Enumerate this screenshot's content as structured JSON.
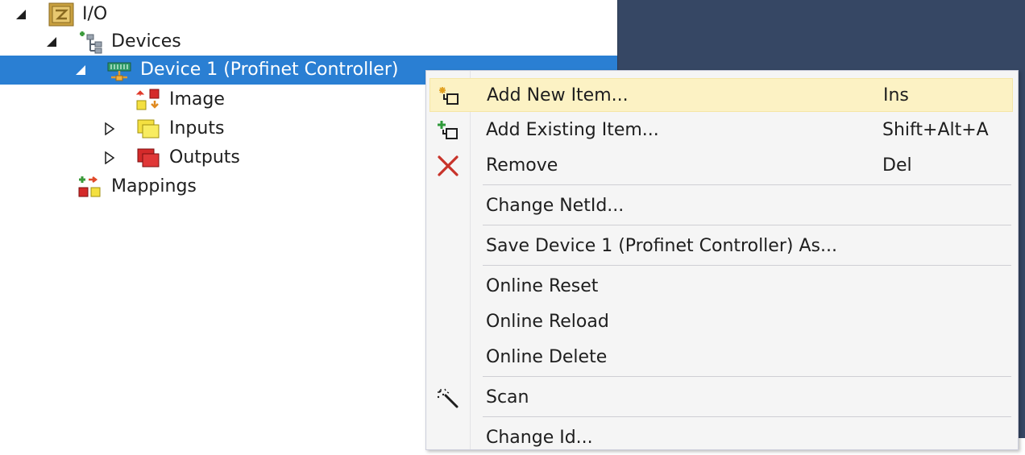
{
  "tree": {
    "io": {
      "label": "I/O",
      "icon": "io-folder-icon"
    },
    "devices": {
      "label": "Devices",
      "icon": "devices-icon"
    },
    "device1": {
      "label": "Device 1 (Profinet Controller)",
      "icon": "profinet-device-icon"
    },
    "image": {
      "label": "Image",
      "icon": "image-icon"
    },
    "inputs": {
      "label": "Inputs",
      "icon": "inputs-icon"
    },
    "outputs": {
      "label": "Outputs",
      "icon": "outputs-icon"
    },
    "mappings": {
      "label": "Mappings",
      "icon": "mappings-icon"
    }
  },
  "context_menu": {
    "items": [
      {
        "label": "Add New Item...",
        "shortcut": "Ins",
        "icon": "add-new-item-icon"
      },
      {
        "label": "Add Existing Item...",
        "shortcut": "Shift+Alt+A",
        "icon": "add-existing-item-icon"
      },
      {
        "label": "Remove",
        "shortcut": "Del",
        "icon": "remove-icon"
      },
      {
        "label": "Change NetId...",
        "shortcut": ""
      },
      {
        "label": "Save Device 1 (Profinet Controller) As...",
        "shortcut": ""
      },
      {
        "label": "Online Reset",
        "shortcut": ""
      },
      {
        "label": "Online Reload",
        "shortcut": ""
      },
      {
        "label": "Online Delete",
        "shortcut": ""
      },
      {
        "label": "Scan",
        "shortcut": "",
        "icon": "scan-wand-icon"
      },
      {
        "label": "Change Id...",
        "shortcut": ""
      }
    ]
  },
  "colors": {
    "selection": "#2a7fd3",
    "menu_hover": "#fcf2c4",
    "side_panel": "#364764"
  }
}
